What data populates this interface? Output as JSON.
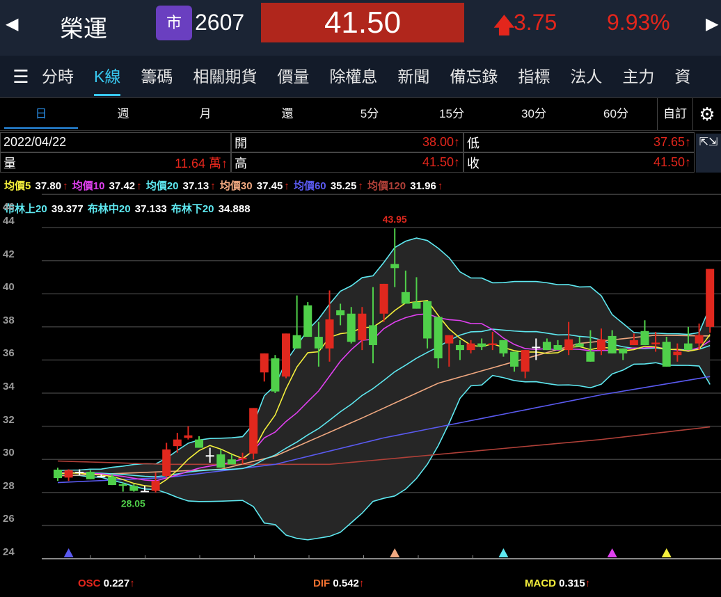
{
  "header": {
    "stock_name": "榮運",
    "market_badge": "市",
    "stock_code": "2607",
    "price": "41.50",
    "change": "3.75",
    "change_pct": "9.93%",
    "up_color": "#e3261c",
    "price_bg": "#b0261c"
  },
  "nav": {
    "items": [
      "分時",
      "K線",
      "籌碼",
      "相關期貨",
      "價量",
      "除權息",
      "新聞",
      "備忘錄",
      "指標",
      "法人",
      "主力",
      "資"
    ],
    "active": 1
  },
  "periods": {
    "items": [
      "日",
      "週",
      "月",
      "還",
      "5分",
      "15分",
      "30分",
      "60分"
    ],
    "active": 0,
    "custom": "自訂"
  },
  "info": {
    "date": "2022/04/22",
    "open_label": "開",
    "open": "38.00↑",
    "low_label": "低",
    "low": "37.65↑",
    "vol_label": "量",
    "vol": "11.64 萬↑",
    "high_label": "高",
    "high": "41.50↑",
    "close_label": "收",
    "close": "41.50↑"
  },
  "ma_legend": [
    {
      "label": "均價5",
      "value": "37.80",
      "color": "#f5f03c"
    },
    {
      "label": "均價10",
      "value": "37.42",
      "color": "#e040f0"
    },
    {
      "label": "均價20",
      "value": "37.13",
      "color": "#5ee8f0"
    },
    {
      "label": "均價30",
      "value": "37.45",
      "color": "#f0a880"
    },
    {
      "label": "均價60",
      "value": "35.25",
      "color": "#5a5af0"
    },
    {
      "label": "均價120",
      "value": "31.96",
      "color": "#b04038"
    }
  ],
  "bb_legend": [
    {
      "label": "布林上20",
      "value": "39.377"
    },
    {
      "label": "布林中20",
      "value": "37.133"
    },
    {
      "label": "布林下20",
      "value": "34.888"
    }
  ],
  "macd": {
    "osc_label": "OSC",
    "osc": "0.227",
    "dif_label": "DIF",
    "dif": "0.542",
    "macd_label": "MACD",
    "macd": "0.315"
  },
  "chart_data": {
    "type": "candlestick",
    "ylim": [
      24,
      46
    ],
    "yticks": [
      "46",
      "44",
      "42",
      "40",
      "38",
      "36",
      "34",
      "32",
      "30",
      "28",
      "26",
      "24"
    ],
    "high_label": "43.95",
    "low_label": "28.05",
    "high_index": 31,
    "low_index": 7,
    "up_color": "#e0281e",
    "down_color": "#50d04a",
    "doji_color": "#ffffff",
    "ohlc": [
      [
        29.38,
        29.5,
        28.7,
        28.87
      ],
      [
        28.9,
        29.4,
        28.7,
        29.35
      ],
      [
        29.25,
        29.4,
        29.05,
        29.25
      ],
      [
        29.25,
        29.35,
        28.8,
        28.8
      ],
      [
        29.0,
        29.1,
        28.9,
        29.0
      ],
      [
        28.96,
        29.1,
        28.45,
        28.45
      ],
      [
        28.5,
        28.6,
        28.05,
        28.4
      ],
      [
        28.4,
        28.5,
        28.05,
        28.1
      ],
      [
        28.1,
        28.4,
        28.1,
        28.1
      ],
      [
        28.1,
        29.2,
        28.0,
        28.7
      ],
      [
        29.0,
        31.0,
        28.9,
        30.6
      ],
      [
        30.8,
        31.6,
        30.4,
        31.2
      ],
      [
        31.3,
        32.0,
        31.2,
        31.45
      ],
      [
        31.2,
        31.4,
        30.7,
        30.7
      ],
      [
        30.25,
        30.7,
        29.8,
        30.25
      ],
      [
        30.3,
        30.6,
        29.5,
        29.5
      ],
      [
        30.0,
        30.3,
        29.7,
        29.7
      ],
      [
        30.0,
        30.4,
        29.7,
        30.1
      ],
      [
        30.35,
        33.1,
        30.0,
        33.1
      ],
      [
        35.25,
        36.4,
        34.7,
        36.4
      ],
      [
        36.1,
        36.3,
        34.0,
        34.1
      ],
      [
        35.0,
        37.6,
        34.9,
        37.6
      ],
      [
        37.5,
        39.9,
        36.7,
        36.7
      ],
      [
        39.3,
        39.5,
        37.4,
        37.4
      ],
      [
        37.4,
        38.3,
        35.6,
        36.7
      ],
      [
        36.7,
        40.2,
        35.9,
        38.45
      ],
      [
        39.0,
        39.4,
        38.1,
        38.7
      ],
      [
        38.8,
        39.2,
        37.0,
        37.1
      ],
      [
        37.2,
        39.2,
        36.6,
        38.8
      ],
      [
        38.1,
        40.4,
        35.8,
        36.9
      ],
      [
        38.8,
        40.6,
        38.3,
        40.6
      ],
      [
        41.8,
        43.95,
        40.4,
        41.55
      ],
      [
        40.1,
        41.4,
        39.4,
        39.4
      ],
      [
        39.5,
        41.0,
        39.1,
        39.1
      ],
      [
        39.55,
        39.55,
        36.7,
        37.3
      ],
      [
        38.6,
        38.6,
        35.5,
        36.1
      ],
      [
        37.0,
        37.5,
        35.6,
        37.5
      ],
      [
        36.9,
        37.2,
        36.0,
        36.6
      ],
      [
        36.6,
        37.2,
        36.4,
        37.0
      ],
      [
        37.0,
        37.3,
        36.6,
        36.8
      ],
      [
        36.9,
        37.7,
        36.6,
        37.0
      ],
      [
        37.2,
        37.2,
        36.2,
        36.4
      ],
      [
        36.5,
        36.5,
        35.3,
        35.6
      ],
      [
        35.3,
        36.6,
        34.9,
        36.6
      ],
      [
        36.8,
        37.3,
        36.0,
        36.8
      ],
      [
        37.1,
        37.3,
        36.6,
        36.6
      ],
      [
        36.9,
        37.2,
        36.6,
        36.6
      ],
      [
        36.6,
        38.3,
        36.3,
        37.25
      ],
      [
        37.0,
        37.4,
        36.8,
        36.8
      ],
      [
        36.5,
        37.8,
        35.9,
        35.9
      ],
      [
        36.6,
        37.9,
        36.3,
        37.25
      ],
      [
        37.45,
        37.8,
        36.4,
        36.4
      ],
      [
        36.7,
        36.7,
        36.0,
        36.4
      ],
      [
        36.9,
        37.6,
        36.9,
        37.2
      ],
      [
        37.75,
        38.4,
        36.9,
        36.9
      ],
      [
        36.95,
        37.7,
        36.5,
        37.05
      ],
      [
        37.1,
        37.4,
        35.6,
        35.6
      ],
      [
        36.3,
        37.0,
        35.9,
        36.5
      ],
      [
        37.0,
        38.0,
        36.6,
        36.6
      ],
      [
        37.0,
        38.2,
        36.6,
        37.5
      ],
      [
        38.0,
        41.5,
        37.65,
        41.5
      ]
    ],
    "ma30": [
      [
        0,
        29.0
      ],
      [
        15,
        29.4
      ],
      [
        20,
        30.2
      ],
      [
        28,
        32.5
      ],
      [
        35,
        34.6
      ],
      [
        42,
        35.9
      ],
      [
        48,
        37.0
      ],
      [
        55,
        37.5
      ],
      [
        60,
        37.45
      ]
    ],
    "ma60": [
      [
        0,
        28.6
      ],
      [
        10,
        28.9
      ],
      [
        20,
        29.7
      ],
      [
        30,
        31.3
      ],
      [
        40,
        32.6
      ],
      [
        50,
        33.9
      ],
      [
        60,
        35.0
      ]
    ],
    "ma120": [
      [
        0,
        29.9
      ],
      [
        10,
        29.7
      ],
      [
        25,
        29.7
      ],
      [
        35,
        30.3
      ],
      [
        50,
        31.2
      ],
      [
        60,
        31.96
      ]
    ],
    "markers": [
      {
        "index": 1,
        "color": "#5a5af0"
      },
      {
        "index": 31,
        "color": "#f0a880"
      },
      {
        "index": 41,
        "color": "#5ee8f0"
      },
      {
        "index": 51,
        "color": "#e040f0"
      },
      {
        "index": 56,
        "color": "#f5f03c"
      }
    ]
  }
}
